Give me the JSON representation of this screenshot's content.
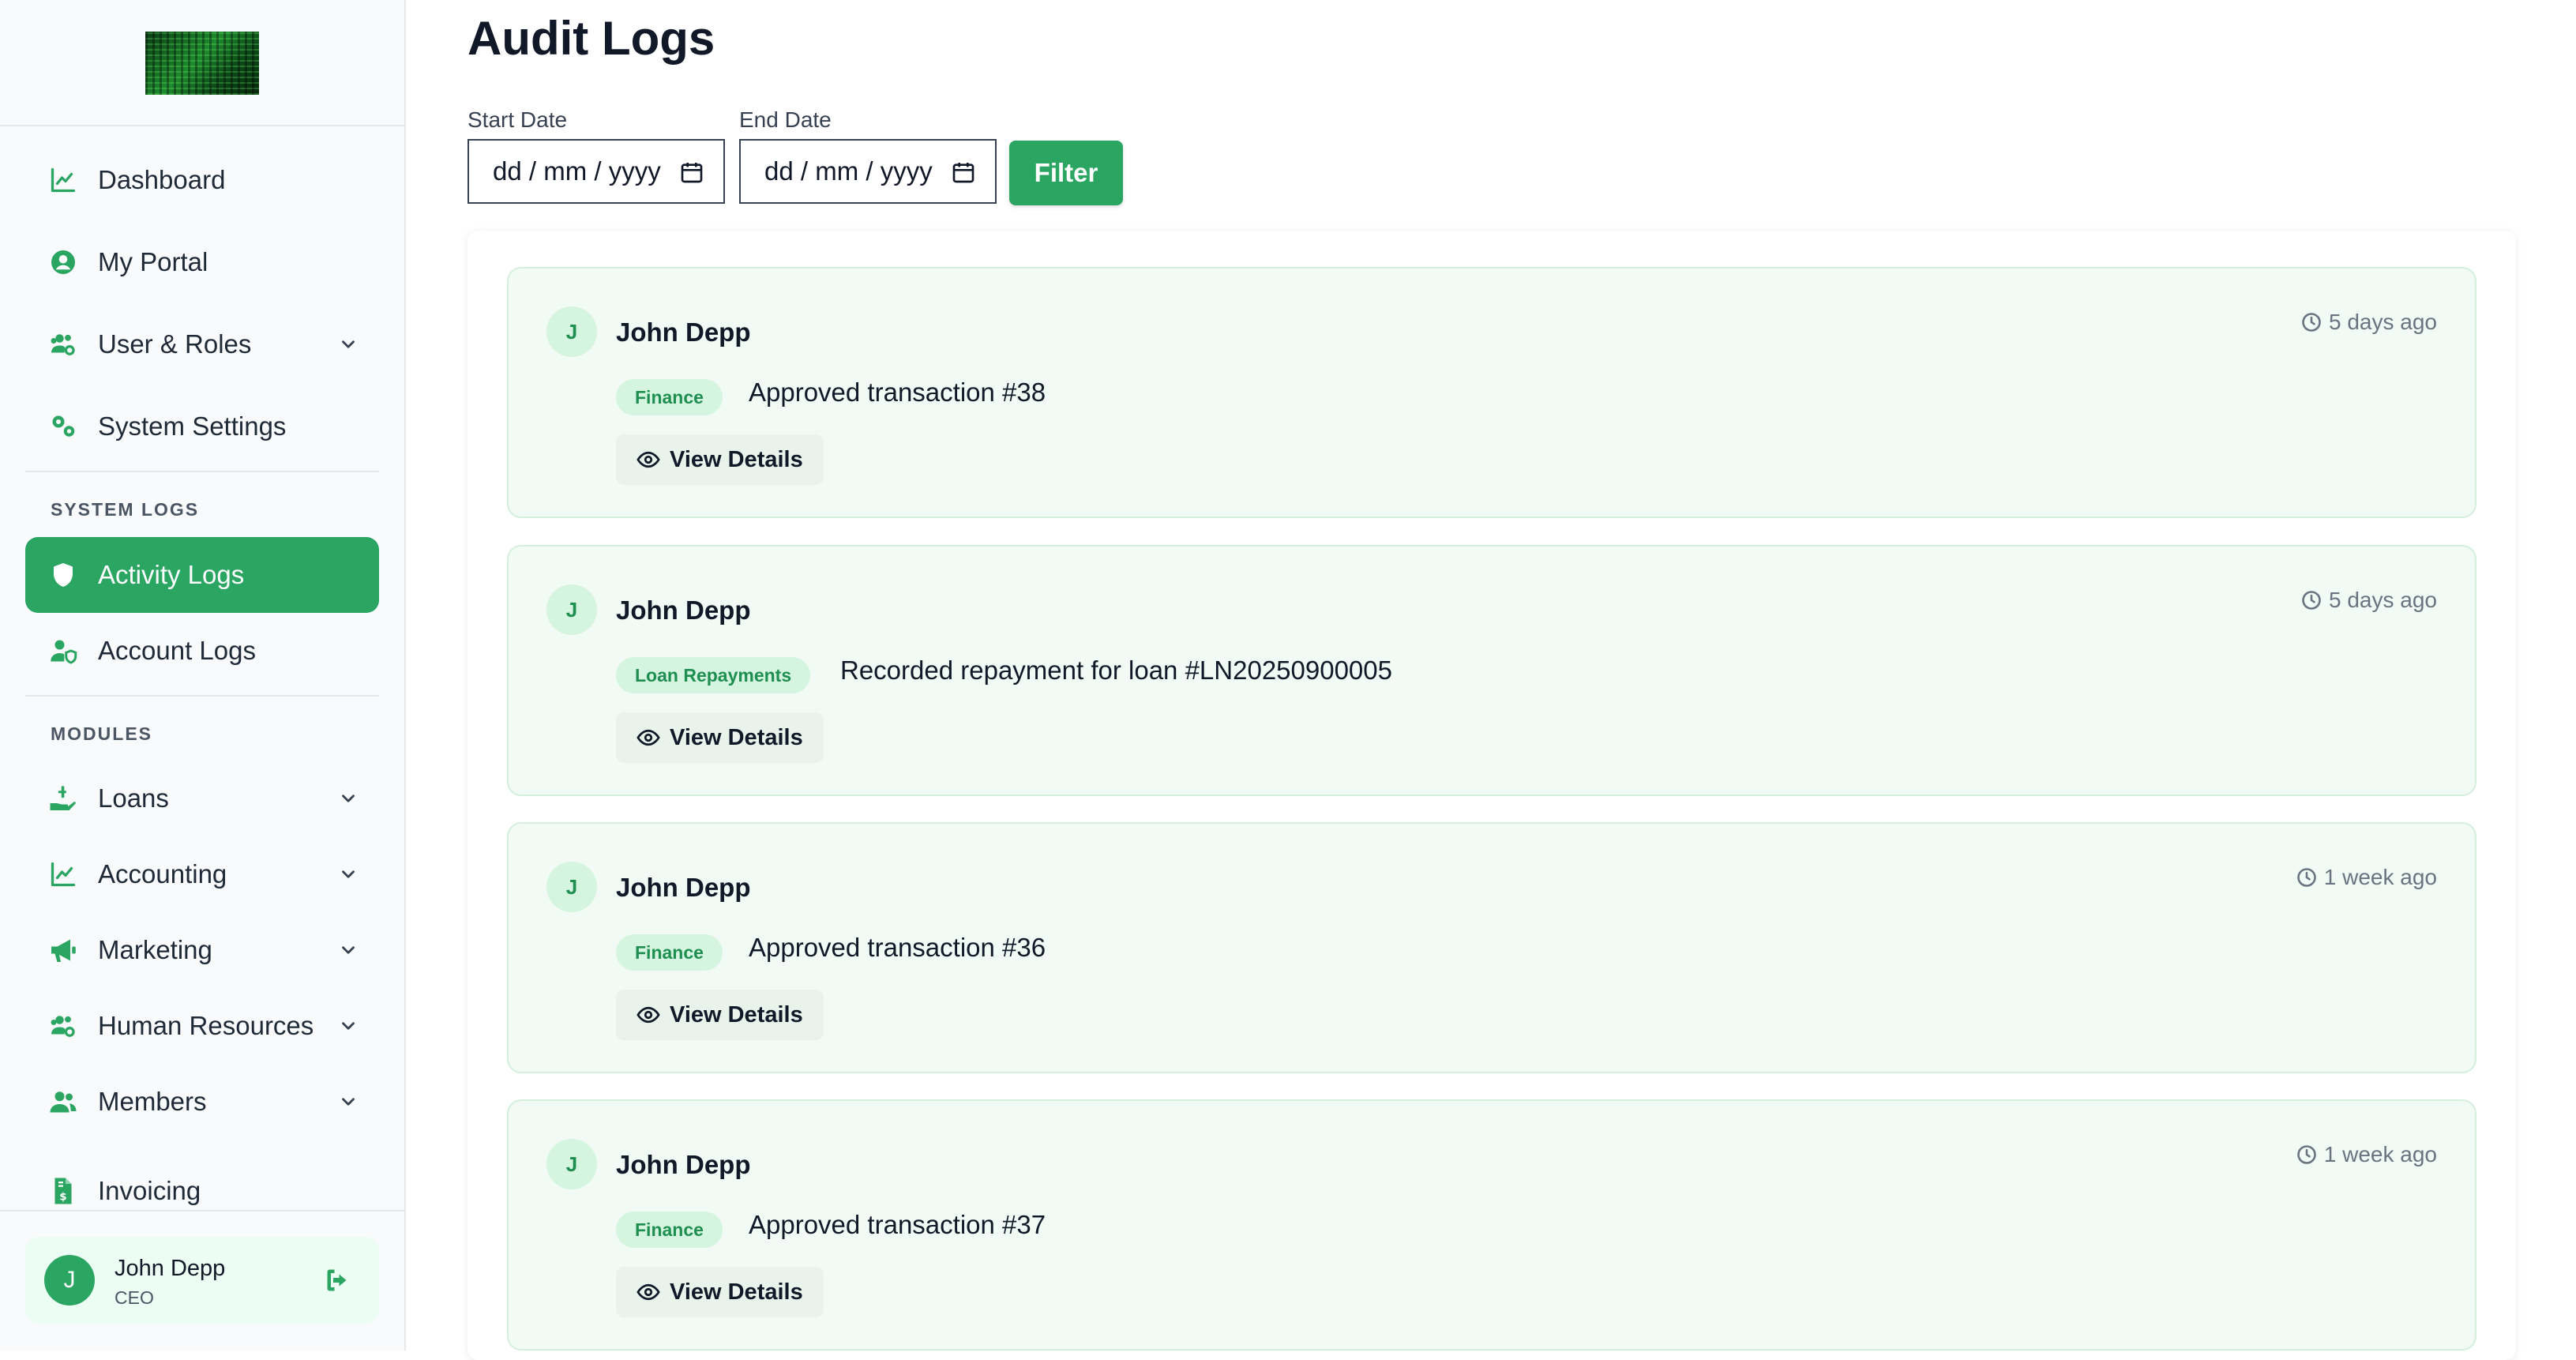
{
  "sidebar": {
    "nav_top": [
      {
        "label": "Dashboard",
        "icon": "chart-line-icon"
      },
      {
        "label": "My Portal",
        "icon": "user-circle-icon"
      },
      {
        "label": "User & Roles",
        "icon": "users-cog-icon",
        "has_submenu": true
      },
      {
        "label": "System Settings",
        "icon": "cogs-icon"
      }
    ],
    "section_system_logs": "SYSTEM LOGS",
    "logs": [
      {
        "label": "Activity Logs",
        "icon": "shield-icon",
        "active": true
      },
      {
        "label": "Account Logs",
        "icon": "user-shield-icon"
      }
    ],
    "section_modules": "MODULES",
    "modules": [
      {
        "label": "Loans",
        "icon": "hand-holding-dollar-icon",
        "has_submenu": true
      },
      {
        "label": "Accounting",
        "icon": "chart-line-icon",
        "has_submenu": true
      },
      {
        "label": "Marketing",
        "icon": "bullhorn-icon",
        "has_submenu": true
      },
      {
        "label": "Human Resources",
        "icon": "users-cog-icon",
        "has_submenu": true
      },
      {
        "label": "Members",
        "icon": "users-icon",
        "has_submenu": true
      },
      {
        "label": "Invoicing",
        "icon": "file-invoice-dollar-icon"
      }
    ],
    "user": {
      "initial": "J",
      "name": "John Depp",
      "role": "CEO"
    }
  },
  "main": {
    "title": "Audit Logs",
    "filters": {
      "start_label": "Start Date",
      "start_value": "dd / mm / yyyy",
      "end_label": "End Date",
      "end_value": "dd / mm / yyyy",
      "filter_button": "Filter"
    },
    "logs": [
      {
        "initial": "J",
        "user": "John Depp",
        "time": "5 days ago",
        "tag": "Finance",
        "description": "Approved transaction #38",
        "action": "View Details"
      },
      {
        "initial": "J",
        "user": "John Depp",
        "time": "5 days ago",
        "tag": "Loan Repayments",
        "description": "Recorded repayment for loan #LN20250900005",
        "action": "View Details"
      },
      {
        "initial": "J",
        "user": "John Depp",
        "time": "1 week ago",
        "tag": "Finance",
        "description": "Approved transaction #36",
        "action": "View Details"
      },
      {
        "initial": "J",
        "user": "John Depp",
        "time": "1 week ago",
        "tag": "Finance",
        "description": "Approved transaction #37",
        "action": "View Details"
      }
    ]
  },
  "colors": {
    "accent": "#2ba562",
    "card_bg": "#f1faf4",
    "tag_bg": "#d5f5e0",
    "tag_text": "#1e8e51"
  }
}
